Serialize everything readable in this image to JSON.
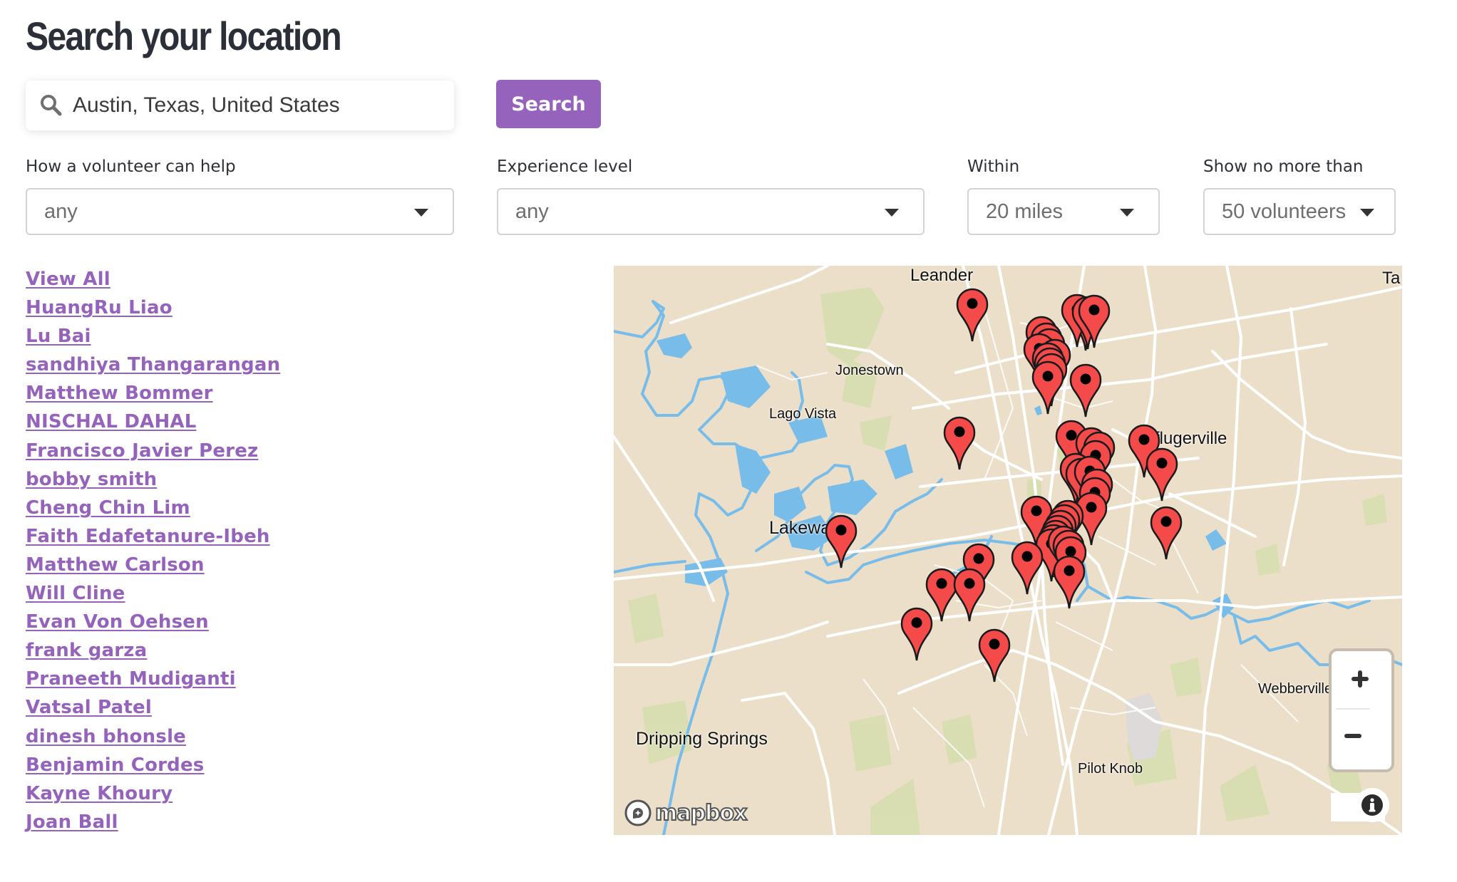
{
  "page": {
    "title": "Search your location"
  },
  "search": {
    "value": "Austin, Texas, United States",
    "icon": "search-icon",
    "button_label": "Search"
  },
  "filters": [
    {
      "label": "How a volunteer can help",
      "selected": "any"
    },
    {
      "label": "Experience level",
      "selected": "any"
    },
    {
      "label": "Within",
      "selected": "20 miles"
    },
    {
      "label": "Show no more than",
      "selected": "50 volunteers"
    }
  ],
  "volunteers": {
    "view_all_label": "View All",
    "names": [
      "HuangRu Liao",
      "Lu Bai",
      "sandhiya Thangarangan",
      "Matthew Bommer",
      "NISCHAL DAHAL",
      "Francisco Javier Perez",
      "bobby smith",
      "Cheng Chin Lim",
      "Faith Edafetanure-Ibeh",
      "Matthew Carlson",
      "Will Cline",
      "Evan Von Oehsen",
      "frank garza",
      "Praneeth Mudiganti",
      "Vatsal Patel",
      "dinesh bhonsle",
      "Benjamin Cordes",
      "Kayne Khoury",
      "Joan Ball"
    ]
  },
  "map": {
    "places": {
      "leander": "Leander",
      "taylor_partial": "Ta",
      "jonestown": "Jonestown",
      "lago_vista": "Lago Vista",
      "pflugerville": "Pflugerville",
      "lakeway": "Lakeway",
      "webberville": "Webberville",
      "dripping_springs": "Dripping Springs",
      "pilot_knob": "Pilot Knob"
    },
    "attribution_logo": "mapbox",
    "zoom_in_label": "+",
    "zoom_out_label": "−",
    "marker_color": "#f44a4a",
    "colors": {
      "land": "#ebdfc9",
      "water": "#78bcea",
      "park": "#cfe0a6",
      "road": "#ffffff",
      "accent": "#9562bc"
    }
  }
}
